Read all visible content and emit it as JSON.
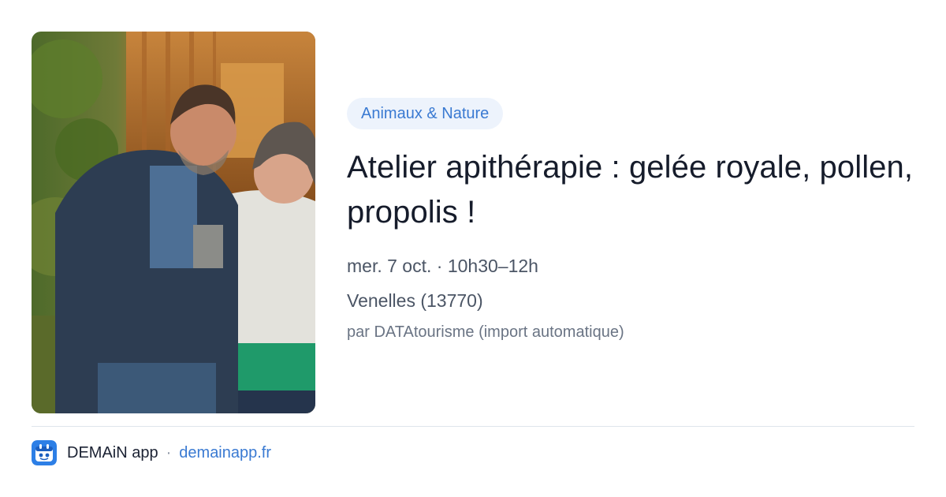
{
  "event": {
    "image_icon": "event-photo",
    "category": "Animaux & Nature",
    "title": "Atelier apithérapie : gelée royale, pollen, propolis !",
    "date": "mer. 7 oct. · 10h30–12h",
    "location": "Venelles (13770)",
    "source": "par DATAtourisme (import automatique)"
  },
  "footer": {
    "app_icon": "demain-app-icon",
    "app_name": "DEMAiN app",
    "separator": "·",
    "url": "demainapp.fr"
  },
  "colors": {
    "accent": "#3a7ad2",
    "chip_background": "#edf3fc",
    "title": "#161c2b",
    "meta": "#4b5565",
    "divider": "#dfe5ec"
  }
}
